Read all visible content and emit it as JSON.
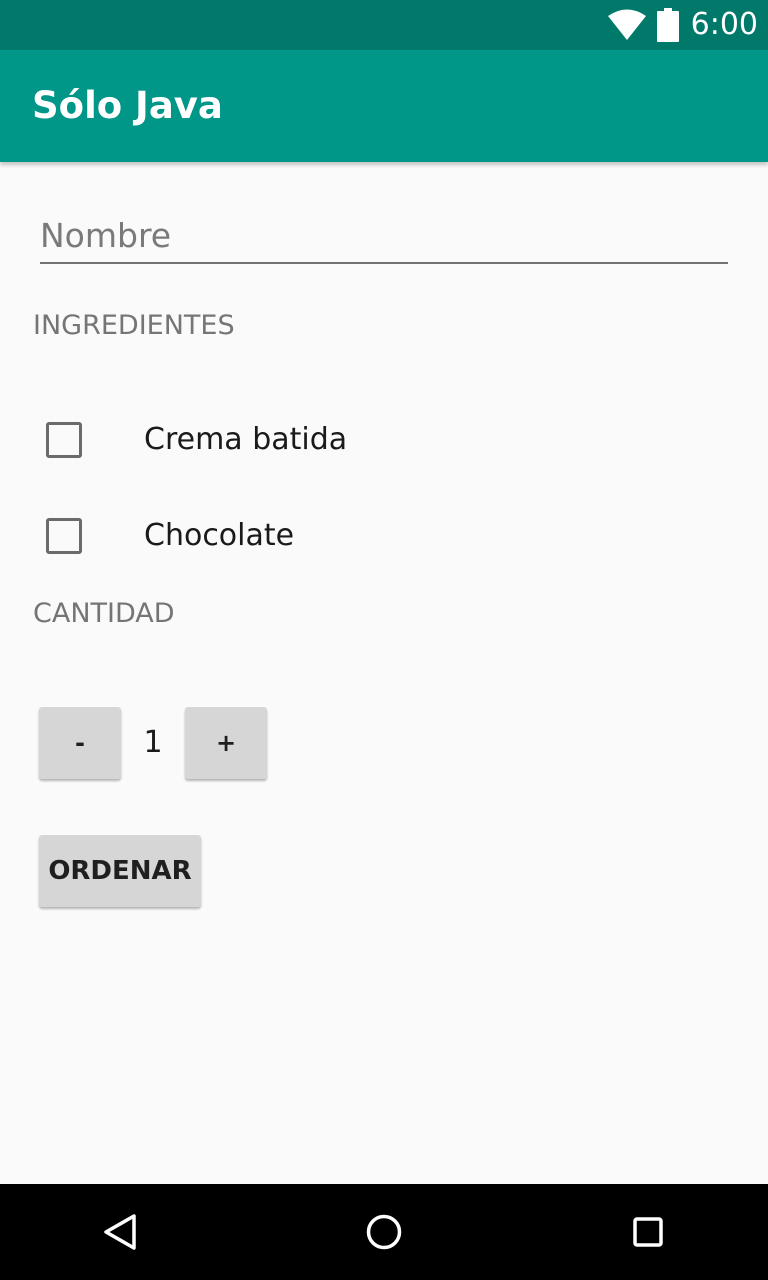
{
  "status_bar": {
    "time": "6:00",
    "icons": [
      "wifi-icon",
      "battery-icon"
    ],
    "color": "#00796b"
  },
  "app_bar": {
    "title": "Sólo Java",
    "color": "#009688"
  },
  "form": {
    "name": {
      "placeholder": "Nombre",
      "value": ""
    },
    "ingredients_label": "INGREDIENTES",
    "ingredients": [
      {
        "label": "Crema batida",
        "checked": false
      },
      {
        "label": "Chocolate",
        "checked": false
      }
    ],
    "quantity_label": "CANTIDAD",
    "quantity": {
      "decrement_label": "-",
      "value": "1",
      "increment_label": "+"
    },
    "order_label": "ORDENAR"
  },
  "nav_bar": {
    "icons": [
      "back-icon",
      "home-icon",
      "recents-icon"
    ]
  }
}
